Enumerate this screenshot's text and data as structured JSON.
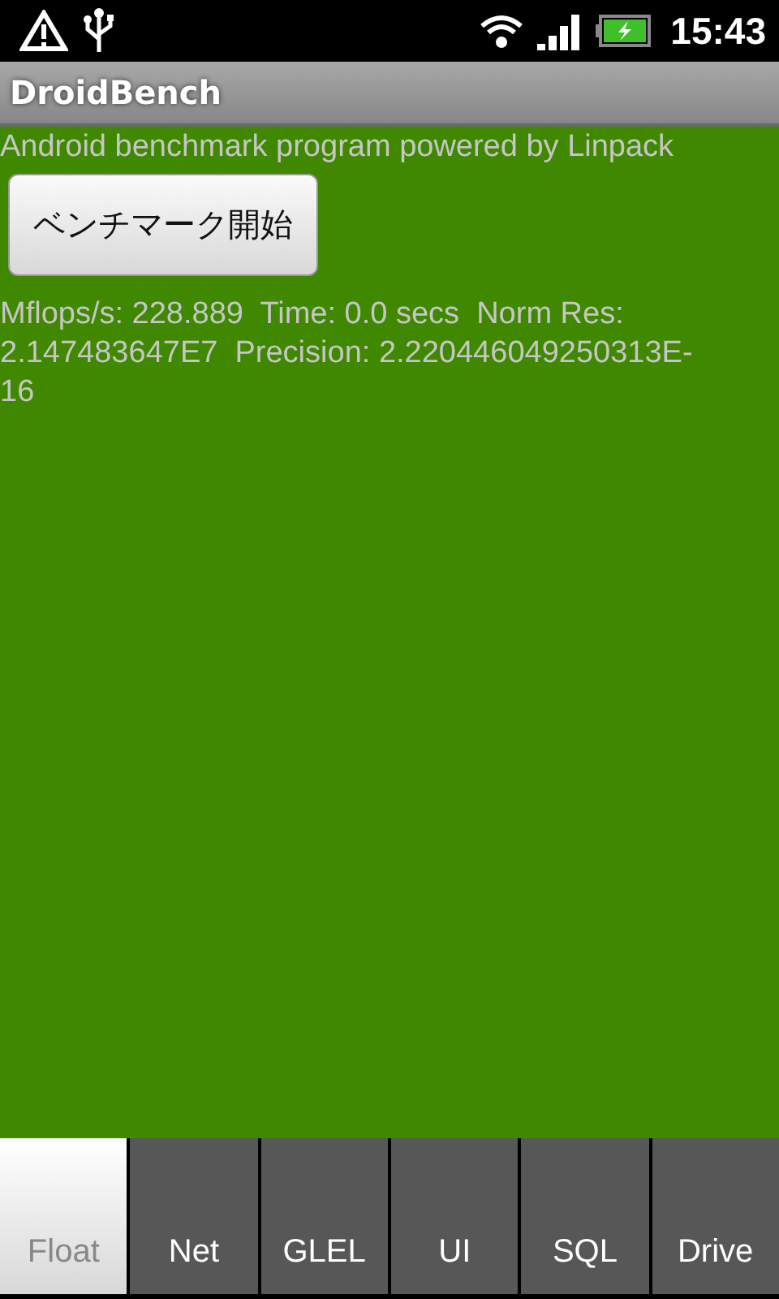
{
  "status_bar": {
    "time": "15:43"
  },
  "window": {
    "title": "DroidBench"
  },
  "description": "Android benchmark program powered by Linpack",
  "start_button": {
    "label": "ベンチマーク開始"
  },
  "result": "Mflops/s: 228.889  Time: 0.0 secs  Norm Res: 2.147483647E7  Precision: 2.220446049250313E-16",
  "tabs": [
    {
      "label": "Float",
      "selected": true
    },
    {
      "label": "Net",
      "selected": false
    },
    {
      "label": "GLEL",
      "selected": false
    },
    {
      "label": "UI",
      "selected": false
    },
    {
      "label": "SQL",
      "selected": false
    },
    {
      "label": "Drive",
      "selected": false
    }
  ]
}
